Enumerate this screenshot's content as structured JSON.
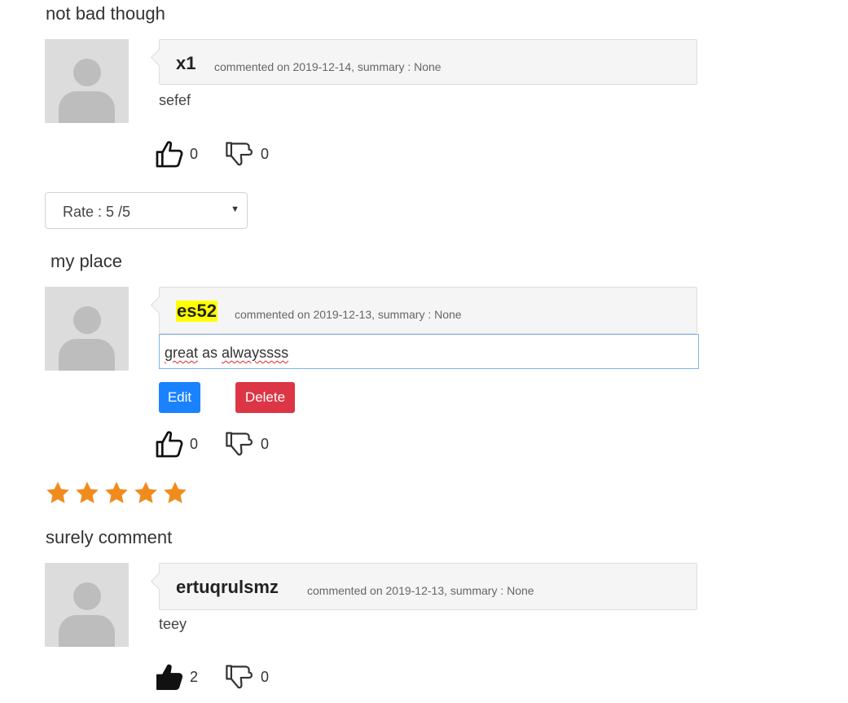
{
  "reviews": [
    {
      "title": "not bad though",
      "author": "x1",
      "meta": "commented on 2019-12-14, summary : None",
      "comment": "sefef",
      "likes": "0",
      "dislikes": "0",
      "liked": false
    },
    {
      "title": "my place",
      "author": "es52",
      "meta": "commented on 2019-12-13, summary : None",
      "comment": "great as alwayssss",
      "comment_words": [
        "great",
        " as ",
        "alwayssss"
      ],
      "likes": "0",
      "dislikes": "0",
      "liked": false,
      "rating": 5
    },
    {
      "title": "surely comment",
      "author": "ertuqrulsmz",
      "meta": "commented on 2019-12-13, summary : None",
      "comment": "teey",
      "likes": "2",
      "dislikes": "0",
      "liked": true
    }
  ],
  "rate_select": {
    "value": "Rate : 5 /5"
  },
  "actions": {
    "edit_label": "Edit",
    "delete_label": "Delete"
  },
  "colors": {
    "star": "#f08c1e",
    "edit": "#1a82ff",
    "delete": "#dc3545",
    "highlight": "#ffff00"
  },
  "icons": {
    "like": "thumbs-up-icon",
    "dislike": "thumbs-down-icon",
    "rating": "star-icon"
  }
}
